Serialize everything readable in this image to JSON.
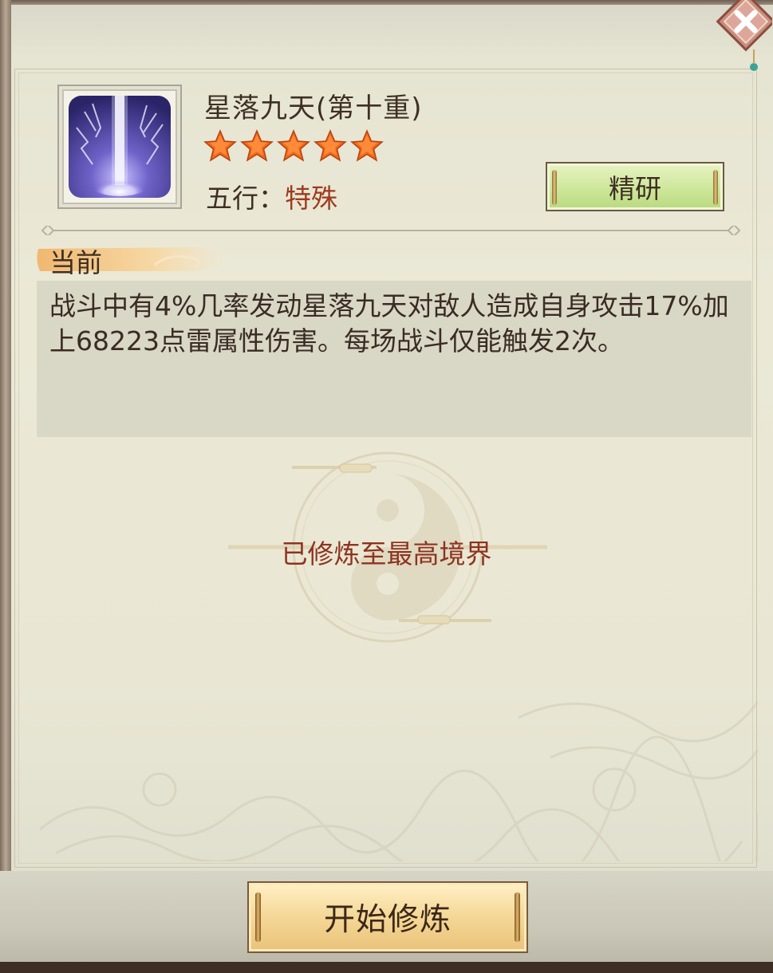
{
  "skill": {
    "name": "星落九天(第十重)",
    "stars": 5,
    "wuxing_key": "五行：",
    "wuxing_value": "特殊",
    "icon": "lightning-strike-icon"
  },
  "buttons": {
    "refine_label": "精研",
    "train_label": "开始修炼",
    "close_icon": "close-icon"
  },
  "current": {
    "section_label": "当前",
    "description": "战斗中有4%几率发动星落九天对敌人造成自身攻击17%加上68223点雷属性伤害。每场战斗仅能触发2次。"
  },
  "status": {
    "max_text": "已修炼至最高境界"
  },
  "colors": {
    "panel_bg": "#e9e7d4",
    "star_orange": "#f06a1c",
    "accent_red": "#9e3a1f",
    "refine_green": "#cde79a",
    "train_gold": "#f5d796"
  }
}
